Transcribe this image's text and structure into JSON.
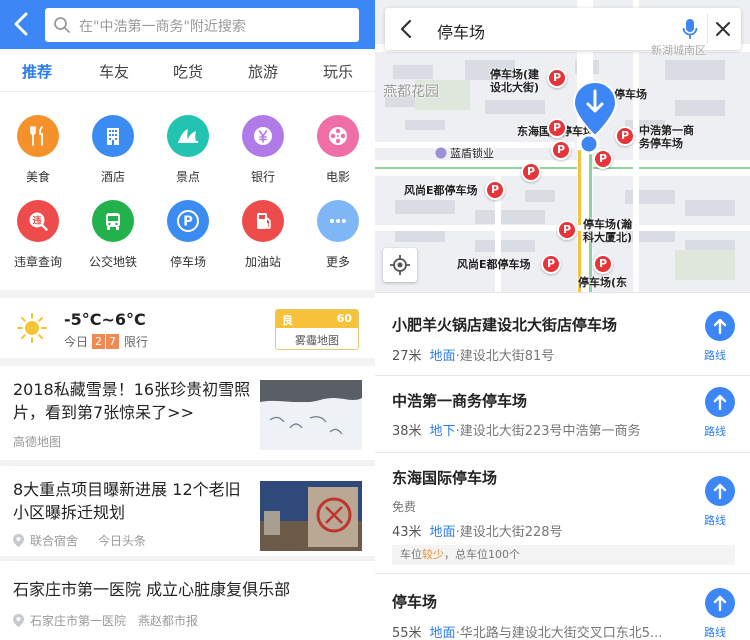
{
  "left": {
    "search": {
      "placeholder": "在\"中浩第一商务\"附近搜索"
    },
    "tabs": [
      {
        "label": "推荐"
      },
      {
        "label": "车友"
      },
      {
        "label": "吃货"
      },
      {
        "label": "旅游"
      },
      {
        "label": "玩乐"
      }
    ],
    "categories": [
      {
        "label": "美食",
        "icon": "fork-knife-icon",
        "color": "#f5912a"
      },
      {
        "label": "酒店",
        "icon": "building-icon",
        "color": "#3b8cf2"
      },
      {
        "label": "景点",
        "icon": "opera-house-icon",
        "color": "#22c3b0"
      },
      {
        "label": "银行",
        "icon": "yuan-icon",
        "color": "#b07be8"
      },
      {
        "label": "电影",
        "icon": "film-reel-icon",
        "color": "#f06ea8"
      },
      {
        "label": "违章查询",
        "icon": "violation-icon",
        "color": "#ee4b4b"
      },
      {
        "label": "公交地铁",
        "icon": "bus-icon",
        "color": "#23b14b"
      },
      {
        "label": "停车场",
        "icon": "parking-icon",
        "color": "#3b8cf2"
      },
      {
        "label": "加油站",
        "icon": "gas-station-icon",
        "color": "#ee4b4b"
      },
      {
        "label": "更多",
        "icon": "more-dots-icon",
        "color": "#7fb6f6"
      }
    ],
    "weather": {
      "temp": "-5°C~6°C",
      "today": "今日",
      "limit_nums": [
        "2",
        "7"
      ],
      "limit_text": "限行",
      "aqi_label": "良",
      "aqi_value": "60",
      "haze_map": "雾霾地图"
    },
    "news": [
      {
        "title": "2018私藏雪景！16张珍贵初雪照片，看到第7张惊呆了>>",
        "source": "高德地图",
        "pin": false
      },
      {
        "title": "8大重点项目曝新进展 12个老旧小区曝拆迁规划",
        "source": "联合宿舍",
        "extra": "今日头条",
        "pin": true
      },
      {
        "title": "石家庄市第一医院 成立心脏康复俱乐部",
        "source": "石家庄市第一医院",
        "extra": "燕赵都市报",
        "pin": true
      }
    ]
  },
  "right": {
    "search": {
      "query": "停车场"
    },
    "map_labels": {
      "p1": "停车场(建\n设北大街)",
      "p2": "停车场",
      "p3": "东海国际停车场",
      "p4": "中浩第一商\n务停车场",
      "p5": "风尚E都停车场",
      "p6": "停车场(瀚\n科大厦北)",
      "p7": "风尚E都停车场",
      "p8": "停车场(东",
      "district": "燕都花园",
      "shop": "蓝盾锁业",
      "street": "新湖城南区"
    },
    "parking_letter": "P",
    "results": [
      {
        "name": "小肥羊火锅店建设北大街店停车场",
        "dist": "27米",
        "level": "地面",
        "addr": "·建设北大街81号",
        "route": "路线"
      },
      {
        "name": "中浩第一商务停车场",
        "dist": "38米",
        "level": "地下",
        "addr": "·建设北大街223号中浩第一商务",
        "route": "路线"
      },
      {
        "name": "东海国际停车场",
        "fee": "免费",
        "dist": "43米",
        "level": "地面",
        "addr": "·建设北大街228号",
        "note_a": "车位",
        "note_warn": "较少",
        "note_b": "，总车位100个",
        "route": "路线"
      },
      {
        "name": "停车场",
        "dist": "55米",
        "level": "地面",
        "addr": "·华北路与建设北大街交叉口东北5...",
        "route": "路线"
      }
    ]
  }
}
